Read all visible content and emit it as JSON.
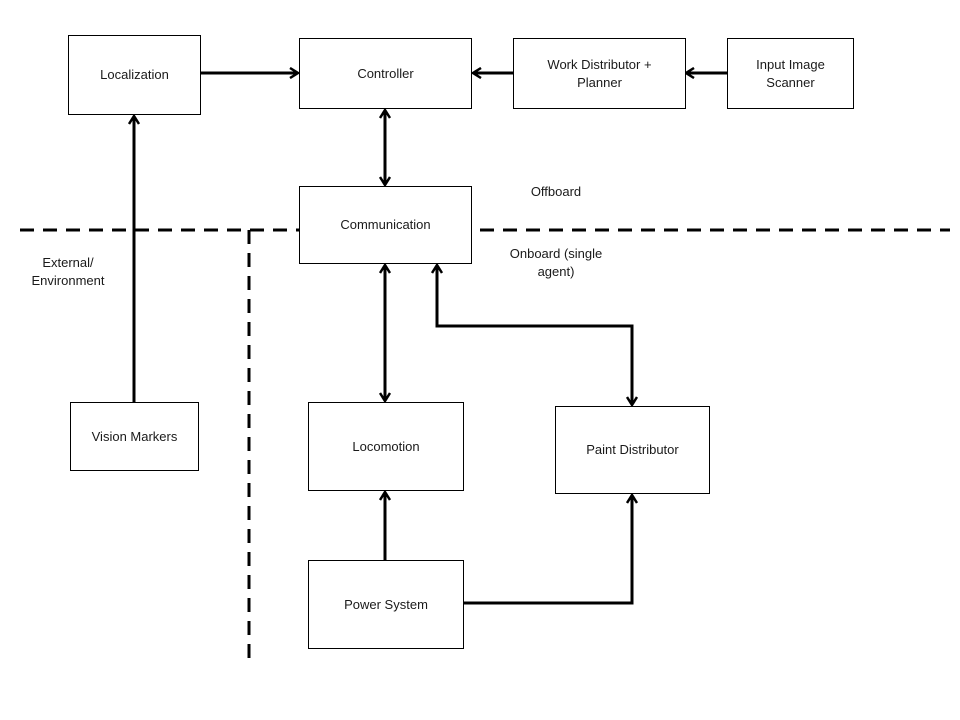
{
  "blocks": {
    "localization": "Localization",
    "controller": "Controller",
    "work_distributor": "Work Distributor + Planner",
    "input_image_scanner": "Input Image Scanner",
    "communication": "Communication",
    "vision_markers": "Vision Markers",
    "locomotion": "Locomotion",
    "paint_distributor": "Paint Distributor",
    "power_system": "Power System"
  },
  "regions": {
    "offboard": "Offboard",
    "onboard": "Onboard (single agent)",
    "external": "External/ Environment"
  },
  "connections": [
    {
      "from": "localization",
      "to": "controller",
      "type": "directed"
    },
    {
      "from": "work_distributor",
      "to": "controller",
      "type": "directed"
    },
    {
      "from": "input_image_scanner",
      "to": "work_distributor",
      "type": "directed"
    },
    {
      "from": "controller",
      "to": "communication",
      "type": "bidirectional"
    },
    {
      "from": "vision_markers",
      "to": "localization",
      "type": "directed"
    },
    {
      "from": "communication",
      "to": "locomotion",
      "type": "bidirectional"
    },
    {
      "from": "communication",
      "to": "paint_distributor",
      "type": "bidirectional"
    },
    {
      "from": "power_system",
      "to": "locomotion",
      "type": "directed"
    },
    {
      "from": "power_system",
      "to": "paint_distributor",
      "type": "directed"
    }
  ]
}
